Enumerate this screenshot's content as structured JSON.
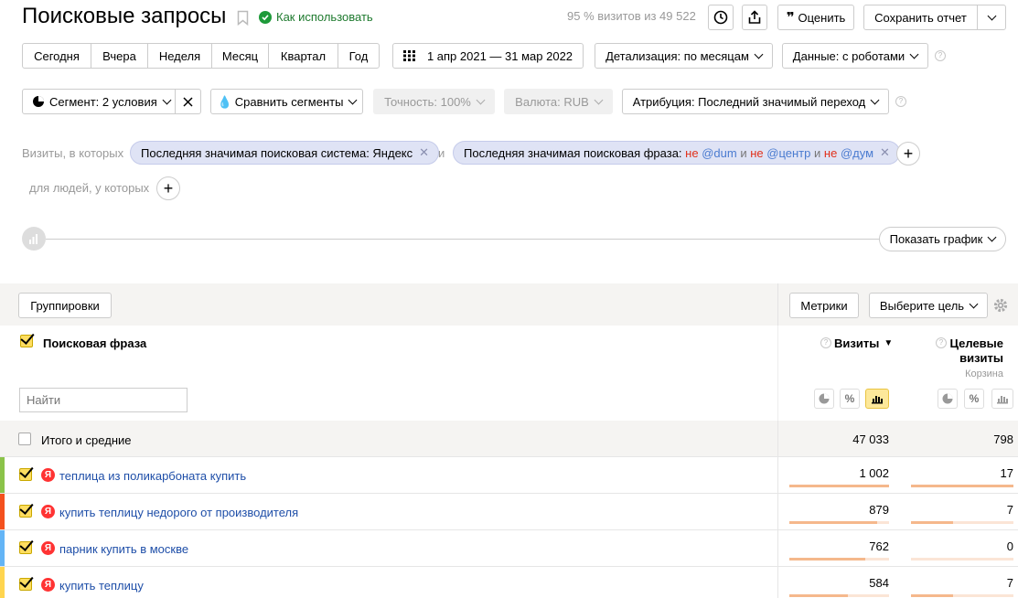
{
  "header": {
    "title": "Поисковые запросы",
    "how_to_use": "Как использовать",
    "visits_share_pct": "95 %",
    "visits_share_text": "визитов из 49 522",
    "rate_label": "Оценить",
    "save_report_label": "Сохранить отчет"
  },
  "periods": [
    "Сегодня",
    "Вчера",
    "Неделя",
    "Месяц",
    "Квартал",
    "Год"
  ],
  "date_range": "1 апр 2021 — 31 мар 2022",
  "detail": "Детализация: по месяцам",
  "data_mode": "Данные: с роботами",
  "segment": {
    "label": "Сегмент: 2 условия",
    "compare": "Сравнить сегменты",
    "accuracy": "Точность: 100%",
    "currency": "Валюта: RUB",
    "attribution": "Атрибуция: Последний значимый переход"
  },
  "filters": {
    "visits_prefix": "Визиты, в которых",
    "chip1": "Последняя значимая поисковая система: Яндекс",
    "and": "и",
    "chip2_prefix": "Последняя значимая поисковая фраза:",
    "not": "не",
    "and_word": "и",
    "term1": "@dum",
    "term2": "@центр",
    "term3": "@дум",
    "people_prefix": "для людей, у которых"
  },
  "chart_toggle": "Показать график",
  "table": {
    "groupings_label": "Группировки",
    "metrics_label": "Метрики",
    "goal_label": "Выберите цель",
    "dimension_header": "Поисковая фраза",
    "search_placeholder": "Найти",
    "col_visits": "Визиты",
    "sort_arrow": "▼",
    "col_goal_line1": "Целевые",
    "col_goal_line2": "визиты",
    "col_goal_sub": "Корзина",
    "total_label": "Итого и средние",
    "total_visits": "47 033",
    "total_goal": "798",
    "rows": [
      {
        "phrase": "теплица из поликарбоната купить",
        "visits": "1 002",
        "goal": "17",
        "color": "#8bc34a",
        "visits_frac": 1.0,
        "goal_frac": 1.0
      },
      {
        "phrase": "купить теплицу недорого от производителя",
        "visits": "879",
        "goal": "7",
        "color": "#f4511e",
        "visits_frac": 0.877,
        "goal_frac": 0.41
      },
      {
        "phrase": "парник купить в москве",
        "visits": "762",
        "goal": "0",
        "color": "#64b5f6",
        "visits_frac": 0.76,
        "goal_frac": 0.0
      },
      {
        "phrase": "купить теплицу",
        "visits": "584",
        "goal": "7",
        "color": "#ffd54f",
        "visits_frac": 0.583,
        "goal_frac": 0.41
      }
    ]
  }
}
